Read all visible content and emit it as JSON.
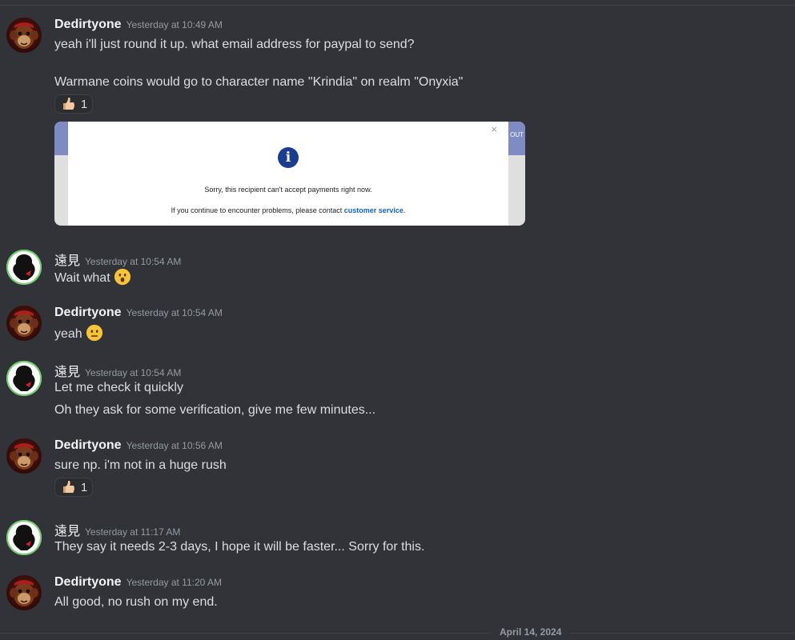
{
  "colors": {
    "background": "#313338",
    "username": "#f2f3f5",
    "timestamp": "#949ba4",
    "message_text": "#dbdee1",
    "reaction_bg": "#2b2d31"
  },
  "messages": [
    {
      "author": "Dedirtyone",
      "timestamp": "Yesterday at 10:49 AM",
      "lines": [
        "yeah i'll just round it up. what email address for paypal to send?",
        "Warmane coins would go to character name \"Krindia\" on realm \"Onyxia\""
      ],
      "reaction": {
        "emoji": "👍🏼",
        "count": "1"
      },
      "attachment": {
        "right_strip_text": "OUT",
        "close_glyph": "×",
        "icon": "i",
        "line1": "Sorry, this recipient can't accept payments right now.",
        "line2_prefix": "If you continue to encounter problems, please contact ",
        "line2_link": "customer service",
        "line2_suffix": "."
      }
    },
    {
      "author": "遠見",
      "timestamp": "Yesterday at 10:54 AM",
      "lines": [
        "Wait what"
      ],
      "emoji": "hushed-face-emoji"
    },
    {
      "author": "Dedirtyone",
      "timestamp": "Yesterday at 10:54 AM",
      "lines": [
        "yeah"
      ],
      "emoji": "neutral-face-emoji"
    },
    {
      "author": "遠見",
      "timestamp": "Yesterday at 10:54 AM",
      "lines": [
        "Let me check it quickly",
        "Oh they ask for some verification, give me few minutes..."
      ]
    },
    {
      "author": "Dedirtyone",
      "timestamp": "Yesterday at 10:56 AM",
      "lines": [
        "sure np. i'm not in a huge rush"
      ],
      "reaction": {
        "emoji": "👍🏼",
        "count": "1"
      }
    },
    {
      "author": "遠見",
      "timestamp": "Yesterday at 11:17 AM",
      "lines": [
        "They say it needs 2-3 days, I hope it will be faster... Sorry for this."
      ]
    },
    {
      "author": "Dedirtyone",
      "timestamp": "Yesterday at 11:20 AM",
      "lines": [
        "All good, no rush on my end."
      ]
    }
  ],
  "date_divider": "April 14, 2024"
}
